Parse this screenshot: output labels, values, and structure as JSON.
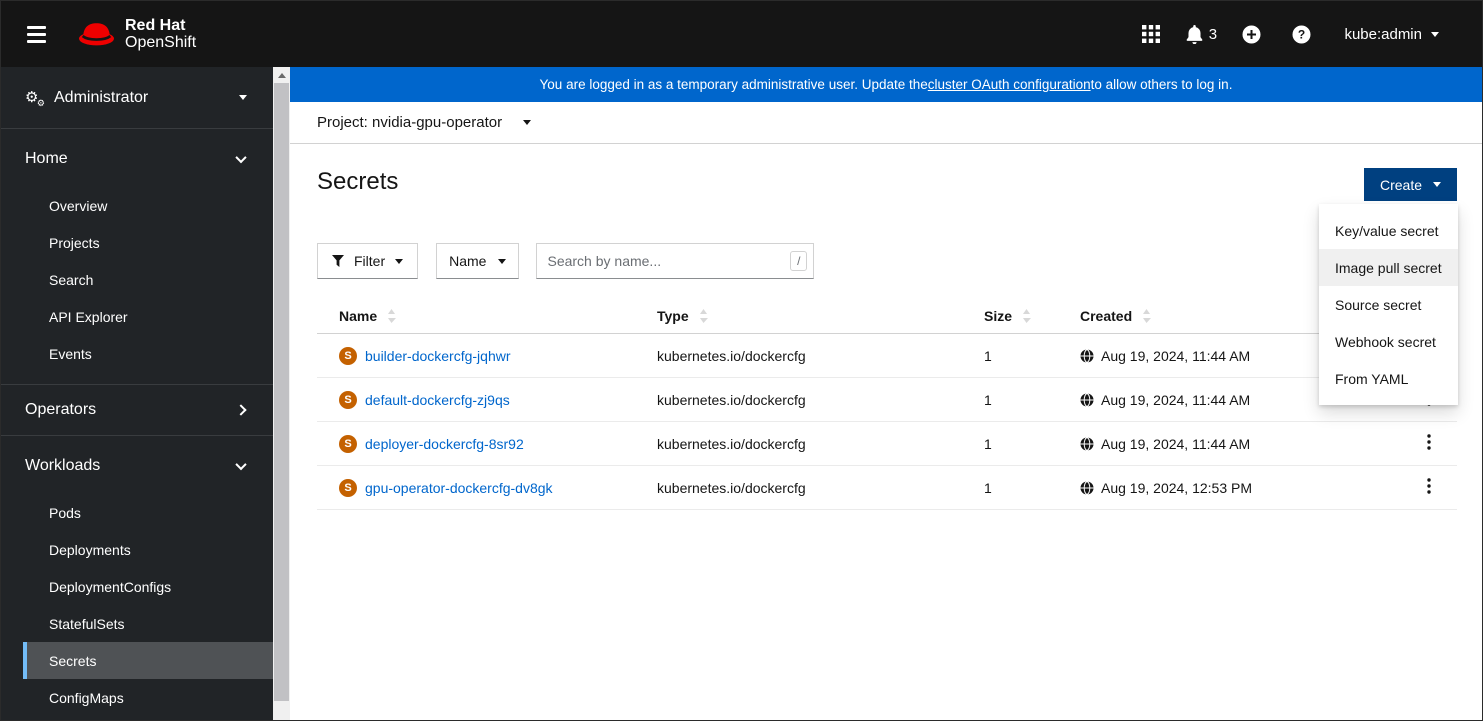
{
  "masthead": {
    "brand_line1": "Red Hat",
    "brand_line2": "OpenShift",
    "notification_count": "3",
    "username": "kube:admin"
  },
  "login_banner": {
    "prefix": "You are logged in as a temporary administrative user. Update the ",
    "link_text": "cluster OAuth configuration",
    "suffix": " to allow others to log in."
  },
  "project_selector": {
    "label": "Project: nvidia-gpu-operator"
  },
  "page": {
    "title": "Secrets",
    "create_button_label": "Create"
  },
  "create_menu": {
    "items": [
      {
        "label": "Key/value secret",
        "highlighted": false
      },
      {
        "label": "Image pull secret",
        "highlighted": true
      },
      {
        "label": "Source secret",
        "highlighted": false
      },
      {
        "label": "Webhook secret",
        "highlighted": false
      },
      {
        "label": "From YAML",
        "highlighted": false
      }
    ]
  },
  "toolbar": {
    "filter_label": "Filter",
    "search_field_label": "Name",
    "search_placeholder": "Search by name...",
    "search_shortcut": "/"
  },
  "secrets_table": {
    "columns": {
      "name": "Name",
      "type": "Type",
      "size": "Size",
      "created": "Created"
    },
    "rows": [
      {
        "badge": "S",
        "name": "builder-dockercfg-jqhwr",
        "type": "kubernetes.io/dockercfg",
        "size": "1",
        "created": "Aug 19, 2024, 11:44 AM"
      },
      {
        "badge": "S",
        "name": "default-dockercfg-zj9qs",
        "type": "kubernetes.io/dockercfg",
        "size": "1",
        "created": "Aug 19, 2024, 11:44 AM"
      },
      {
        "badge": "S",
        "name": "deployer-dockercfg-8sr92",
        "type": "kubernetes.io/dockercfg",
        "size": "1",
        "created": "Aug 19, 2024, 11:44 AM"
      },
      {
        "badge": "S",
        "name": "gpu-operator-dockercfg-dv8gk",
        "type": "kubernetes.io/dockercfg",
        "size": "1",
        "created": "Aug 19, 2024, 12:53 PM"
      }
    ]
  },
  "sidebar": {
    "perspective_label": "Administrator",
    "groups": [
      {
        "label": "Home",
        "state": "expanded",
        "items": [
          {
            "label": "Overview",
            "active": false
          },
          {
            "label": "Projects",
            "active": false
          },
          {
            "label": "Search",
            "active": false
          },
          {
            "label": "API Explorer",
            "active": false
          },
          {
            "label": "Events",
            "active": false
          }
        ]
      },
      {
        "label": "Operators",
        "state": "collapsed",
        "items": []
      },
      {
        "label": "Workloads",
        "state": "expanded",
        "items": [
          {
            "label": "Pods",
            "active": false
          },
          {
            "label": "Deployments",
            "active": false
          },
          {
            "label": "DeploymentConfigs",
            "active": false
          },
          {
            "label": "StatefulSets",
            "active": false
          },
          {
            "label": "Secrets",
            "active": true
          },
          {
            "label": "ConfigMaps",
            "active": false
          }
        ]
      }
    ]
  },
  "icons": {
    "masthead": [
      "hamburger-menu-icon",
      "redhat-fedora-logo",
      "app-launcher-grid-icon",
      "notification-bell-icon",
      "add-plus-circle-icon",
      "help-question-circle-icon"
    ],
    "content": [
      "cogs-icon",
      "filter-funnel-icon",
      "sort-arrows-icon",
      "secret-badge",
      "globe-icon",
      "kebab-menu-icon",
      "scrollbar-up-icon"
    ]
  },
  "colors": {
    "masthead_bg": "#151515",
    "sidebar_bg": "#212427",
    "sidebar_active_bg": "#4f5255",
    "sidebar_active_border": "#73bcf7",
    "banner_bg": "#0066cc",
    "create_button_bg": "#004080",
    "link_color": "#0066cc",
    "secret_badge_bg": "#c46100",
    "menu_highlight_bg": "#f0f0f0"
  }
}
